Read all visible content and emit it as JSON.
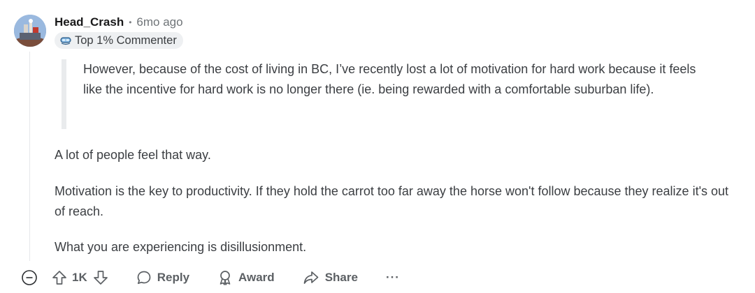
{
  "comment": {
    "username": "Head_Crash",
    "separator": "•",
    "time": "6mo ago",
    "flair": "Top 1% Commenter",
    "quote": "However, because of the cost of living in BC, I’ve recently lost a lot of motivation for hard work because it feels like the incentive for hard work is no longer there (ie. being rewarded with a comfortable suburban life).",
    "paragraphs": [
      "A lot of people feel that way.",
      "Motivation is the key to productivity.  If they hold the carrot too far away the horse won't follow because they realize it's out of reach.",
      "What you are experiencing is disillusionment."
    ]
  },
  "actions": {
    "vote_count": "1K",
    "reply_label": "Reply",
    "award_label": "Award",
    "share_label": "Share",
    "more_label": "···"
  },
  "icons": {
    "collapse": "minus-circle-icon",
    "upvote": "arrow-up-icon",
    "downvote": "arrow-down-icon",
    "reply": "speech-bubble-icon",
    "award": "award-ribbon-icon",
    "share": "share-arrow-icon",
    "flair": "snorkel-mask-icon"
  },
  "colors": {
    "text": "#1c1c1c",
    "muted": "#6f7478",
    "quote_bar": "#e9ebed",
    "flair_bg": "#eef0f2"
  }
}
